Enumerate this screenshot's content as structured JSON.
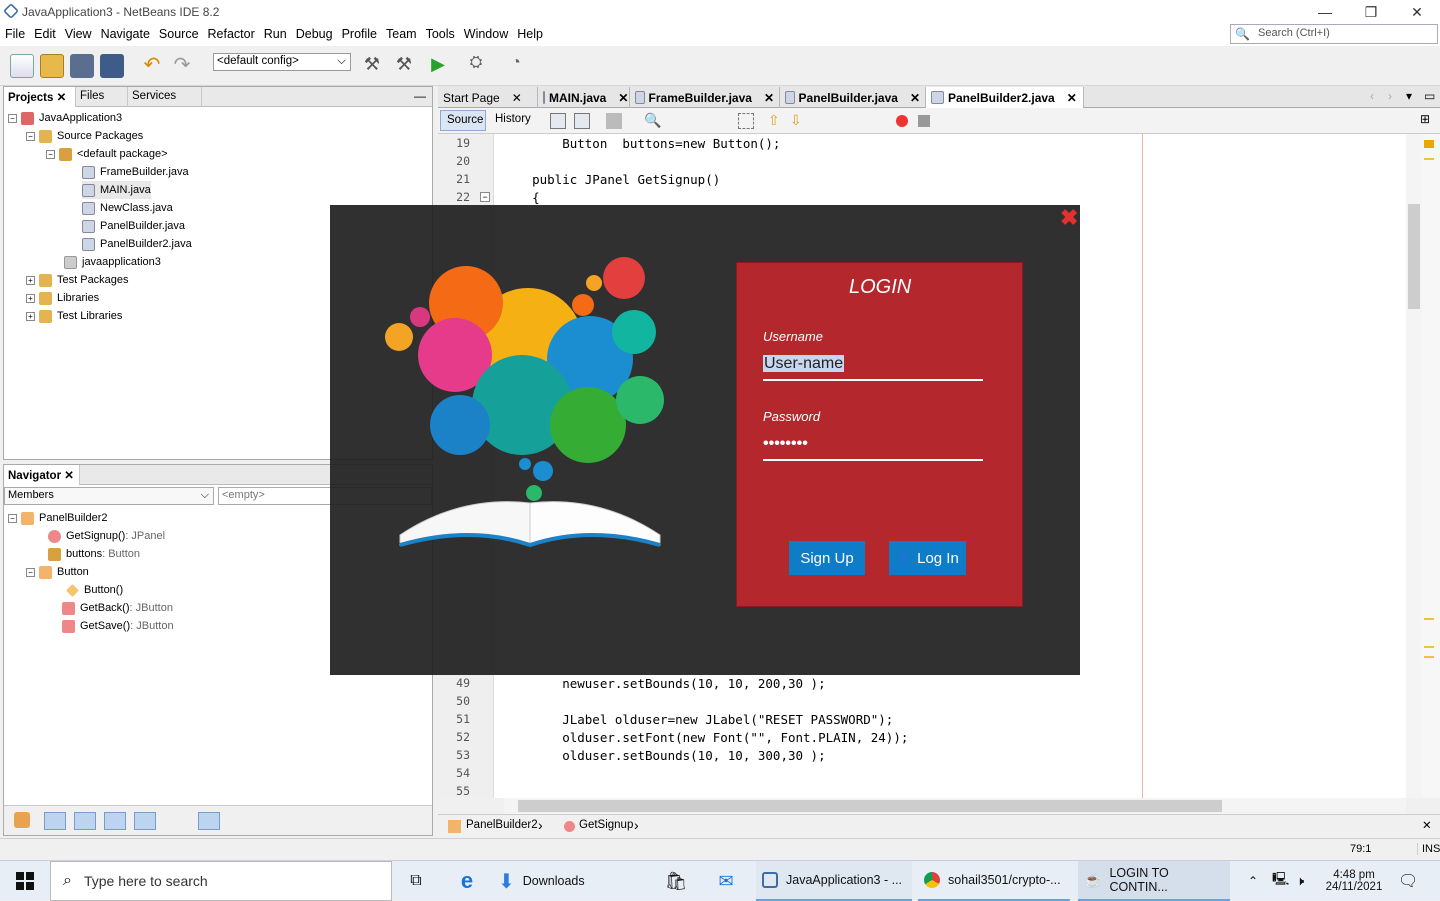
{
  "window": {
    "title": "JavaApplication3 - NetBeans IDE 8.2"
  },
  "menu": [
    "File",
    "Edit",
    "View",
    "Navigate",
    "Source",
    "Refactor",
    "Run",
    "Debug",
    "Profile",
    "Team",
    "Tools",
    "Window",
    "Help"
  ],
  "search": {
    "placeholder": "Search (Ctrl+I)"
  },
  "toolbar": {
    "config": "<default config>"
  },
  "projects_panel": {
    "tabs": [
      "Projects",
      "Files",
      "Services"
    ],
    "tree": [
      {
        "label": "JavaApplication3",
        "level": 0
      },
      {
        "label": "Source Packages",
        "level": 1
      },
      {
        "label": "<default package>",
        "level": 2
      },
      {
        "label": "FrameBuilder.java",
        "level": 3
      },
      {
        "label": "MAIN.java",
        "level": 3
      },
      {
        "label": "NewClass.java",
        "level": 3
      },
      {
        "label": "PanelBuilder.java",
        "level": 3
      },
      {
        "label": "PanelBuilder2.java",
        "level": 3
      },
      {
        "label": "javaapplication3",
        "level": 2
      },
      {
        "label": "Test Packages",
        "level": 1
      },
      {
        "label": "Libraries",
        "level": 1
      },
      {
        "label": "Test Libraries",
        "level": 1
      }
    ]
  },
  "navigator": {
    "title": "Navigator",
    "filter": "Members",
    "empty": "<empty>",
    "tree": [
      {
        "label": "PanelBuilder2",
        "type": "",
        "level": 0
      },
      {
        "label": "GetSignup()",
        "type": " : JPanel",
        "level": 1
      },
      {
        "label": "buttons",
        "type": " : Button",
        "level": 1
      },
      {
        "label": "Button",
        "type": "",
        "level": 1
      },
      {
        "label": "Button()",
        "type": "",
        "level": 2
      },
      {
        "label": "GetBack()",
        "type": " : JButton",
        "level": 2
      },
      {
        "label": "GetSave()",
        "type": " : JButton",
        "level": 2
      }
    ]
  },
  "editor": {
    "tabs": [
      "Start Page",
      "MAIN.java",
      "FrameBuilder.java",
      "PanelBuilder.java",
      "PanelBuilder2.java"
    ],
    "mode_tabs": [
      "Source",
      "History"
    ],
    "breadcrumb": [
      "PanelBuilder2",
      "GetSignup"
    ],
    "lines": [
      {
        "n": "19",
        "code": "        Button  buttons=new Button();"
      },
      {
        "n": "20",
        "code": ""
      },
      {
        "n": "21",
        "code": "    public JPanel GetSignup()"
      },
      {
        "n": "22",
        "code": "    {"
      },
      {
        "n": "49",
        "code": "        newuser.setBounds(10, 10, 200,30 );"
      },
      {
        "n": "50",
        "code": ""
      },
      {
        "n": "51",
        "code": "        JLabel olduser=new JLabel(\"RESET PASSWORD\");"
      },
      {
        "n": "52",
        "code": "        olduser.setFont(new Font(\"\", Font.PLAIN, 24));"
      },
      {
        "n": "53",
        "code": "        olduser.setBounds(10, 10, 300,30 );"
      },
      {
        "n": "54",
        "code": ""
      },
      {
        "n": "55",
        "code": ""
      }
    ]
  },
  "dialog": {
    "title": "LOGIN",
    "username_label": "Username",
    "username_value": "User-name",
    "password_label": "Password",
    "password_value": "••••••••",
    "signup": "Sign Up",
    "login": "Log In"
  },
  "status": {
    "position": "79:1",
    "mode": "INS"
  },
  "taskbar": {
    "search": "Type here to search",
    "items": [
      "Downloads",
      "JavaApplication3 - ...",
      "sohail3501/crypto-...",
      "LOGIN TO CONTIN..."
    ],
    "time": "4:48 pm",
    "date": "24/11/2021"
  }
}
